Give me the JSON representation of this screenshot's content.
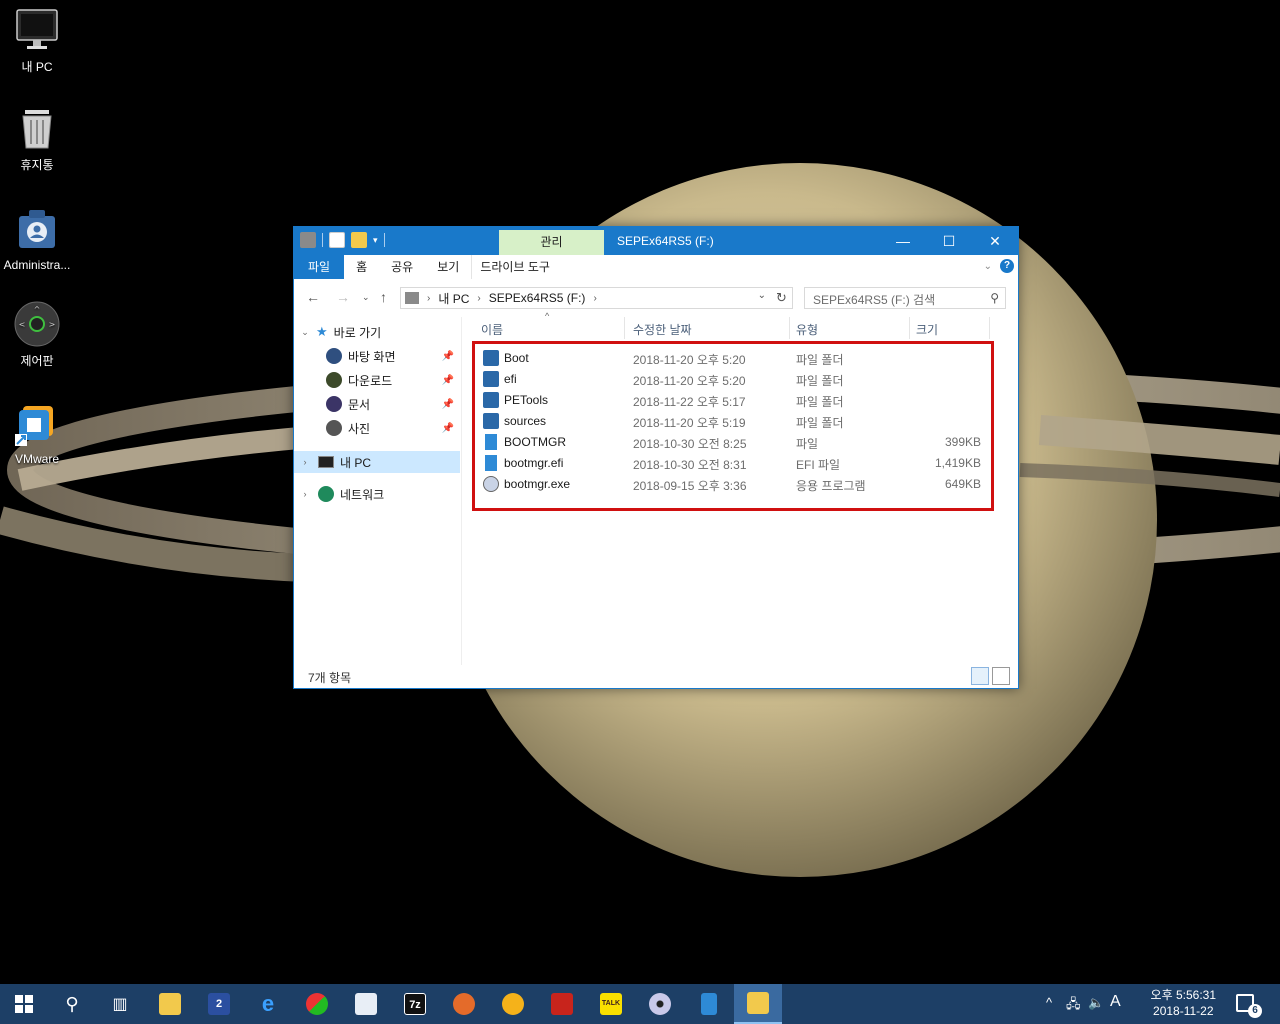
{
  "desktop": {
    "icons": [
      {
        "label": "내 PC",
        "icon": "monitor-icon"
      },
      {
        "label": "휴지통",
        "icon": "recycle-bin-icon"
      },
      {
        "label": "Administra...",
        "icon": "user-folder-icon"
      },
      {
        "label": "제어판",
        "icon": "control-panel-icon"
      },
      {
        "label": "VMware",
        "icon": "vmware-icon"
      }
    ]
  },
  "window": {
    "title": "SEPEx64RS5 (F:)",
    "context_tab": "관리",
    "controls": {
      "minimize": "—",
      "maximize": "☐",
      "close": "✕"
    },
    "ribbon_tabs": [
      "파일",
      "홈",
      "공유",
      "보기",
      "드라이브 도구"
    ],
    "address": {
      "crumbs": [
        "내 PC",
        "SEPEx64RS5 (F:)"
      ]
    },
    "search_placeholder": "SEPEx64RS5 (F:) 검색",
    "nav": {
      "quick_access": "바로 가기",
      "pinned": [
        {
          "label": "바탕 화면",
          "icon": "desktop-icon"
        },
        {
          "label": "다운로드",
          "icon": "download-icon"
        },
        {
          "label": "문서",
          "icon": "documents-icon"
        },
        {
          "label": "사진",
          "icon": "pictures-icon"
        }
      ],
      "this_pc": "내 PC",
      "network": "네트워크"
    },
    "columns": {
      "name": "이름",
      "date": "수정한 날짜",
      "type": "유형",
      "size": "크기"
    },
    "files": [
      {
        "name": "Boot",
        "date": "2018-11-20 오후 5:20",
        "type": "파일 폴더",
        "size": "",
        "icon": "folder-icon"
      },
      {
        "name": "efi",
        "date": "2018-11-20 오후 5:20",
        "type": "파일 폴더",
        "size": "",
        "icon": "folder-icon"
      },
      {
        "name": "PETools",
        "date": "2018-11-22 오후 5:17",
        "type": "파일 폴더",
        "size": "",
        "icon": "folder-icon"
      },
      {
        "name": "sources",
        "date": "2018-11-20 오후 5:19",
        "type": "파일 폴더",
        "size": "",
        "icon": "folder-icon"
      },
      {
        "name": "BOOTMGR",
        "date": "2018-10-30 오전 8:25",
        "type": "파일",
        "size": "399KB",
        "icon": "file-icon"
      },
      {
        "name": "bootmgr.efi",
        "date": "2018-10-30 오전 8:31",
        "type": "EFI 파일",
        "size": "1,419KB",
        "icon": "file-icon"
      },
      {
        "name": "bootmgr.exe",
        "date": "2018-09-15 오후 3:36",
        "type": "응용 프로그램",
        "size": "649KB",
        "icon": "exe-icon"
      }
    ],
    "status": "7개 항목"
  },
  "taskbar": {
    "apps": [
      "start-icon",
      "search-icon",
      "task-view-icon",
      "file-explorer-icon",
      "total-commander-icon",
      "internet-explorer-icon",
      "app-icon",
      "notepad-icon",
      "7zip-icon",
      "eye-icon",
      "triangle-icon",
      "app-red-icon",
      "kakaotalk-icon",
      "disc-icon",
      "document-icon",
      "file-explorer-active-icon"
    ],
    "glyph_7z": "7z",
    "glyph_2": "2",
    "glyph_talk": "TALK",
    "ime": "A",
    "time": "오후 5:56:31",
    "date": "2018-11-22",
    "notifications": "6"
  }
}
